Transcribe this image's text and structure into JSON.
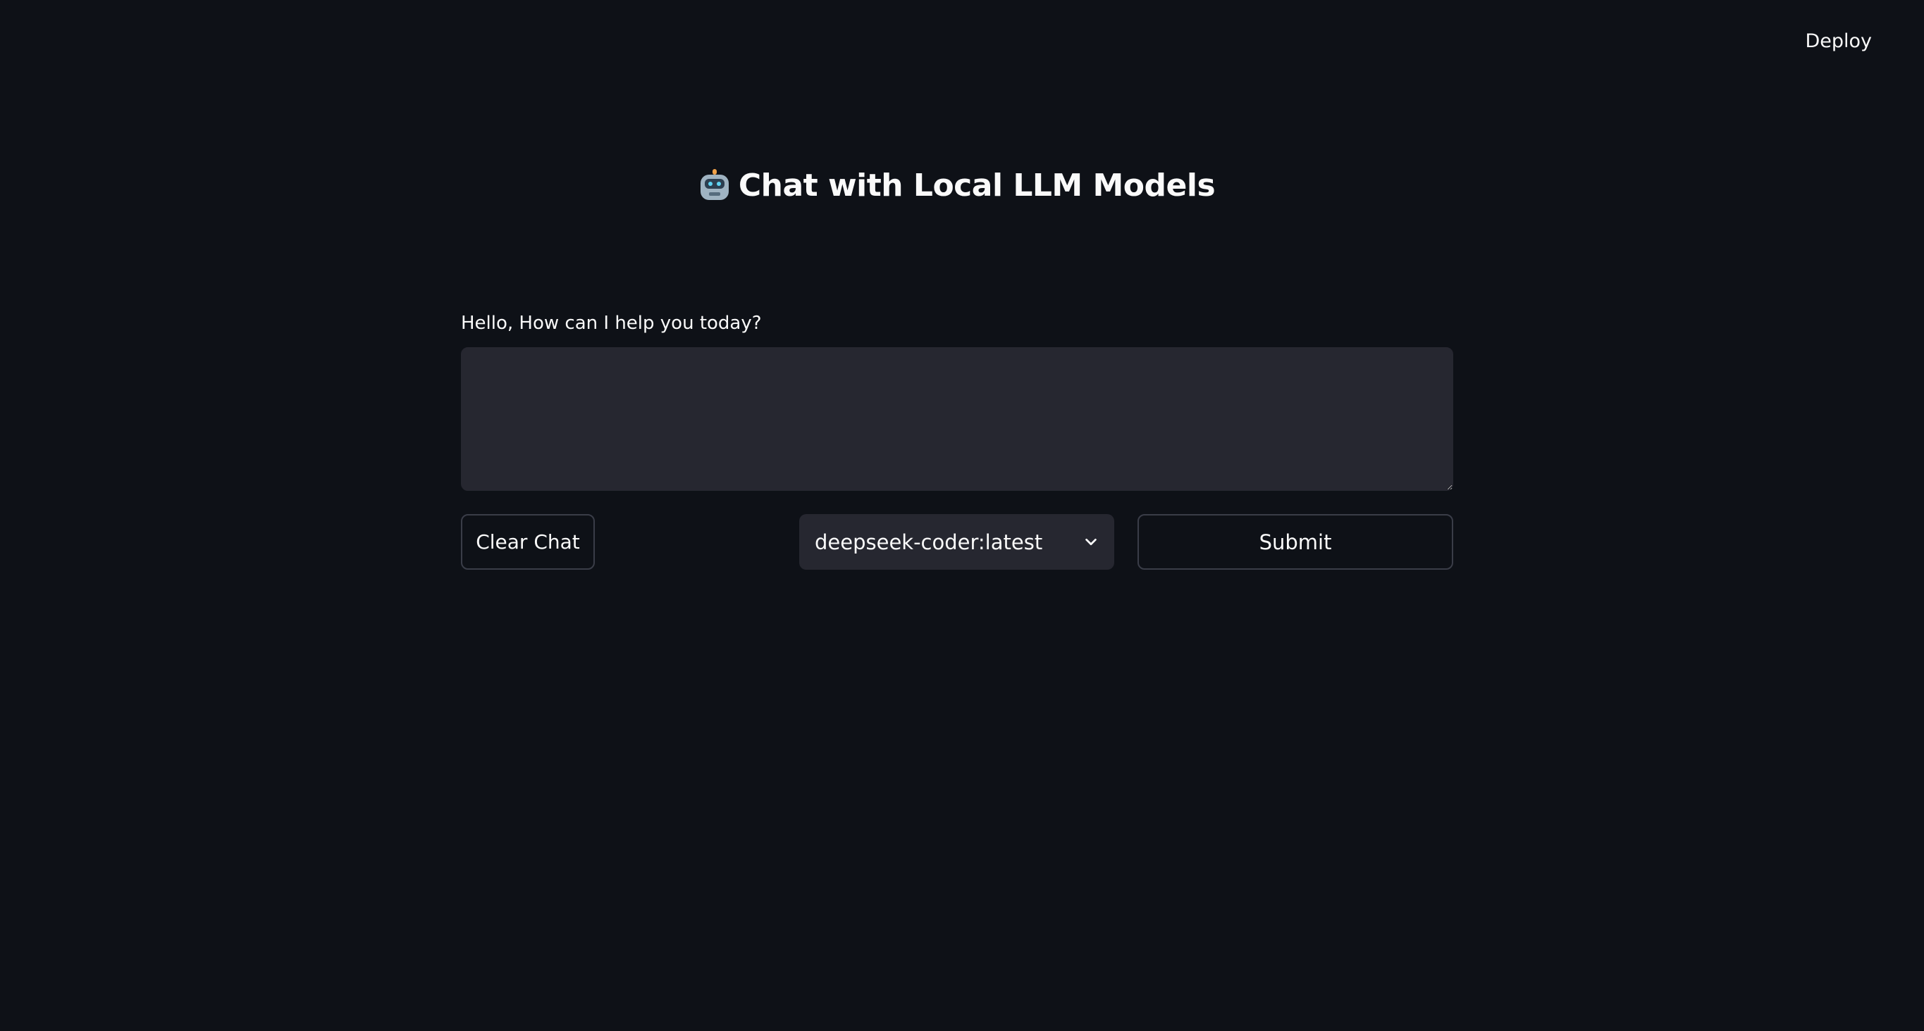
{
  "header": {
    "deploy_label": "Deploy"
  },
  "main": {
    "title_icon": "robot-icon",
    "title": "Chat with Local LLM Models",
    "prompt_label": "Hello, How can I help you today?",
    "prompt_value": "",
    "clear_label": "Clear Chat",
    "model_selected": "deepseek-coder:latest",
    "submit_label": "Submit"
  },
  "colors": {
    "background": "#0e1117",
    "input_background": "#262730",
    "border": "#3a3d48",
    "text": "#fafafa"
  }
}
